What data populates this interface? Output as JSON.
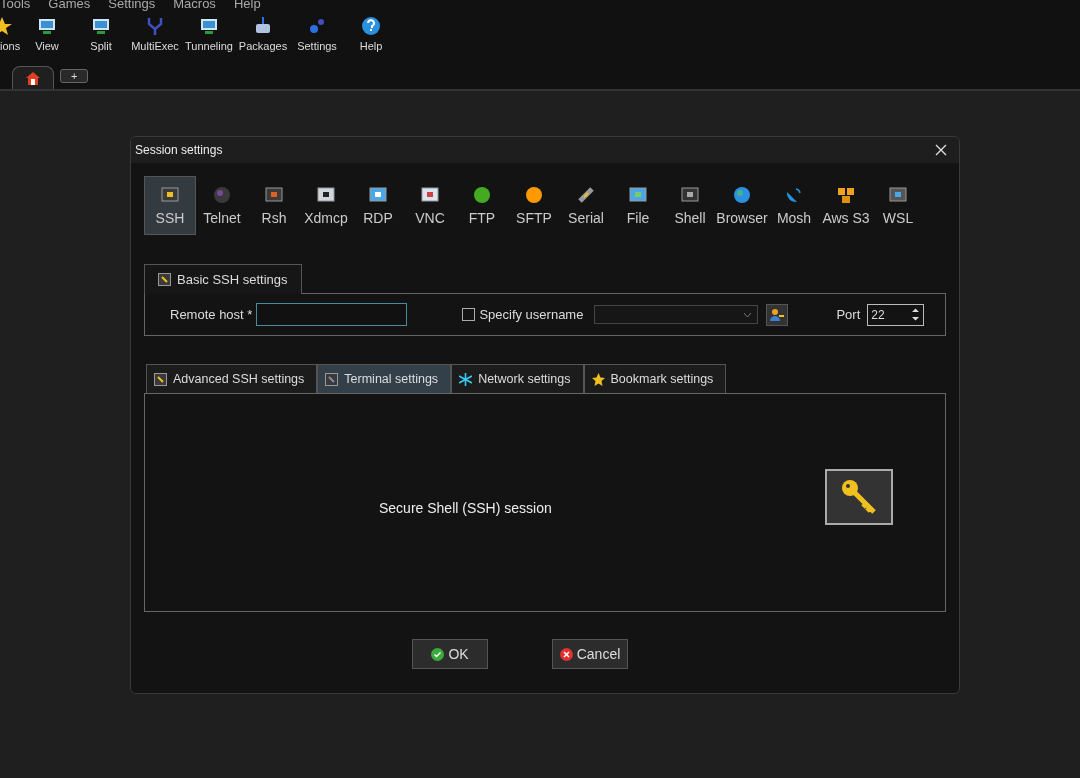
{
  "menu": [
    "Tools",
    "Games",
    "Settings",
    "Macros",
    "Help"
  ],
  "toolbar": [
    "ions",
    "View",
    "Split",
    "MultiExec",
    "Tunneling",
    "Packages",
    "Settings",
    "Help"
  ],
  "tabs": [
    {
      "label": "+",
      "selected": false
    }
  ],
  "dialog": {
    "title": "Session settings",
    "session_types": [
      {
        "label": "SSH",
        "selected": true
      },
      {
        "label": "Telnet",
        "selected": false
      },
      {
        "label": "Rsh",
        "selected": false
      },
      {
        "label": "Xdmcp",
        "selected": false
      },
      {
        "label": "RDP",
        "selected": false
      },
      {
        "label": "VNC",
        "selected": false
      },
      {
        "label": "FTP",
        "selected": false
      },
      {
        "label": "SFTP",
        "selected": false
      },
      {
        "label": "Serial",
        "selected": false
      },
      {
        "label": "File",
        "selected": false
      },
      {
        "label": "Shell",
        "selected": false
      },
      {
        "label": "Browser",
        "selected": false
      },
      {
        "label": "Mosh",
        "selected": false
      },
      {
        "label": "Aws S3",
        "selected": false
      },
      {
        "label": "WSL",
        "selected": false
      }
    ],
    "basic_tab": "Basic SSH settings",
    "remote_host_label": "Remote host *",
    "specify_username": {
      "label": "Specify username",
      "checked": false
    },
    "port_label": "Port",
    "port_value": "22",
    "sub_tabs": [
      {
        "label": "Advanced SSH settings",
        "selected": false
      },
      {
        "label": "Terminal settings",
        "selected": true
      },
      {
        "label": "Network settings",
        "selected": false
      },
      {
        "label": "Bookmark settings",
        "selected": false
      }
    ],
    "description": "Secure Shell (SSH) session",
    "buttons": [
      {
        "label": "OK",
        "kind": "ok"
      },
      {
        "label": "Cancel",
        "kind": "cancel"
      }
    ]
  }
}
